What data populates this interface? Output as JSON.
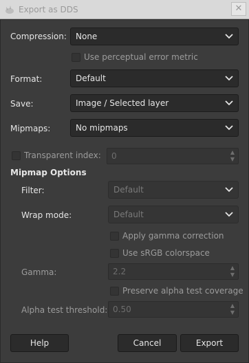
{
  "window": {
    "title": "Export as DDS",
    "close_glyph": "✕"
  },
  "compression": {
    "label": "Compression:",
    "value": "None"
  },
  "perceptual": {
    "label": "Use perceptual error metric"
  },
  "format": {
    "label": "Format:",
    "value": "Default"
  },
  "save": {
    "label": "Save:",
    "value": "Image / Selected layer"
  },
  "mipmaps": {
    "label": "Mipmaps:",
    "value": "No mipmaps"
  },
  "transparent": {
    "label": "Transparent index:",
    "value": "0"
  },
  "mipmap_options": {
    "title": "Mipmap Options",
    "filter": {
      "label": "Filter:",
      "value": "Default"
    },
    "wrap": {
      "label": "Wrap mode:",
      "value": "Default"
    },
    "gamma_correction": {
      "label": "Apply gamma correction"
    },
    "srgb": {
      "label": "Use sRGB colorspace"
    },
    "gamma": {
      "label": "Gamma:",
      "value": "2.2"
    },
    "preserve_alpha": {
      "label": "Preserve alpha test coverage"
    },
    "alpha_threshold": {
      "label": "Alpha test threshold:",
      "value": "0.50"
    }
  },
  "buttons": {
    "help": "Help",
    "cancel": "Cancel",
    "export": "Export"
  },
  "colors": {
    "background": "#3c3c3c",
    "field": "#2b2b2b",
    "text": "#e6e6e6",
    "disabled_text": "#7a7a7a"
  }
}
